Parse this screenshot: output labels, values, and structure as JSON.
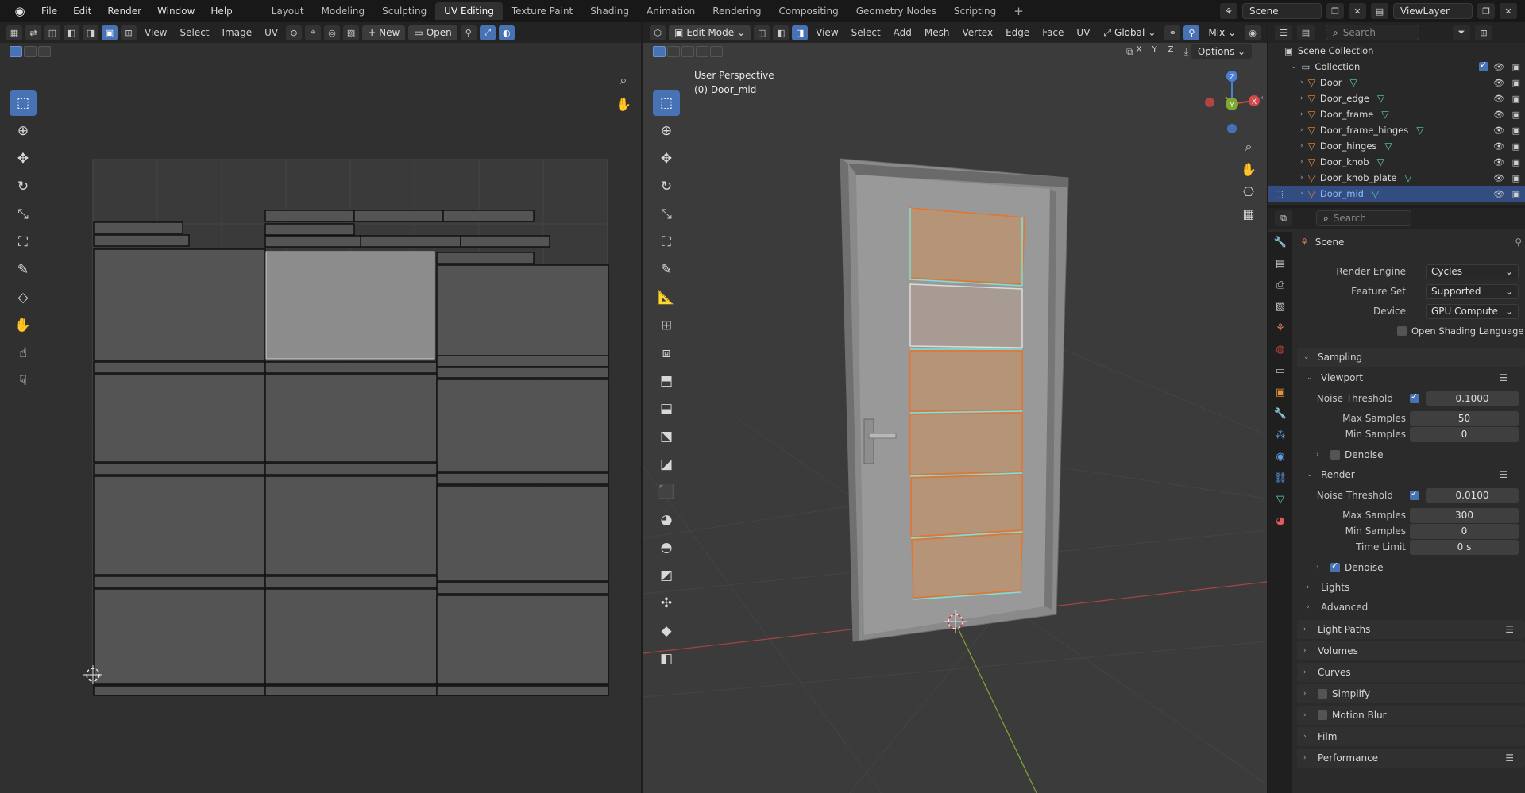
{
  "topbar": {
    "menu": [
      "File",
      "Edit",
      "Render",
      "Window",
      "Help"
    ],
    "workspaces": [
      "Layout",
      "Modeling",
      "Sculpting",
      "UV Editing",
      "Texture Paint",
      "Shading",
      "Animation",
      "Rendering",
      "Compositing",
      "Geometry Nodes",
      "Scripting"
    ],
    "active_workspace": "UV Editing",
    "scene": "Scene",
    "view_layer": "ViewLayer"
  },
  "uv_editor": {
    "menu": [
      "View",
      "Select",
      "Image",
      "UV"
    ],
    "new_label": "New",
    "open_label": "Open"
  },
  "viewport": {
    "mode": "Edit Mode",
    "menu": [
      "View",
      "Select",
      "Add",
      "Mesh",
      "Vertex",
      "Edge",
      "Face",
      "UV"
    ],
    "orientation": "Global",
    "shading": "Mix",
    "options_label": "Options",
    "axes": [
      "X",
      "Y",
      "Z"
    ],
    "view_name": "User Perspective",
    "object_label": "(0) Door_mid"
  },
  "outliner": {
    "search_placeholder": "Search",
    "root": "Scene Collection",
    "collection": "Collection",
    "items": [
      "Door",
      "Door_edge",
      "Door_frame",
      "Door_frame_hinges",
      "Door_hinges",
      "Door_knob",
      "Door_knob_plate",
      "Door_mid"
    ],
    "selected": "Door_mid"
  },
  "properties": {
    "search_placeholder": "Search",
    "context": "Scene",
    "render_engine_label": "Render Engine",
    "render_engine": "Cycles",
    "feature_set_label": "Feature Set",
    "feature_set": "Supported",
    "device_label": "Device",
    "device": "GPU Compute",
    "osl_label": "Open Shading Language",
    "sampling": "Sampling",
    "viewport": "Viewport",
    "vp_noise_label": "Noise Threshold",
    "vp_noise": "0.1000",
    "vp_max_label": "Max Samples",
    "vp_max": "50",
    "vp_min_label": "Min Samples",
    "vp_min": "0",
    "denoise": "Denoise",
    "render": "Render",
    "r_noise_label": "Noise Threshold",
    "r_noise": "0.0100",
    "r_max_label": "Max Samples",
    "r_max": "300",
    "r_min_label": "Min Samples",
    "r_min": "0",
    "time_limit_label": "Time Limit",
    "time_limit": "0 s",
    "r_denoise": "Denoise",
    "lights": "Lights",
    "advanced": "Advanced",
    "sections": [
      "Light Paths",
      "Volumes",
      "Curves",
      "Simplify",
      "Motion Blur",
      "Film",
      "Performance"
    ]
  },
  "colors": {
    "accent": "#4772b3",
    "selected_face": "#8c8c8c",
    "orange_edge": "#e8732a",
    "teal_edge": "#7fe0d8",
    "face_fill": "#b59478"
  }
}
